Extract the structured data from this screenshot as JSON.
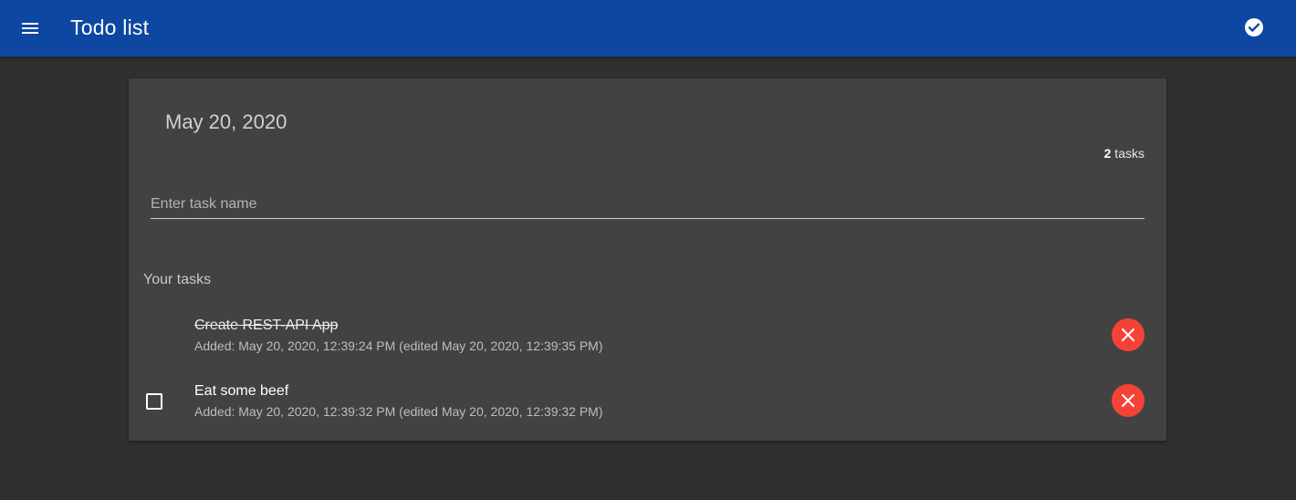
{
  "appbar": {
    "title": "Todo list",
    "color": "#0d47a1",
    "menu_icon": "menu-icon",
    "action_icon": "check-circle-icon"
  },
  "card": {
    "date": "May 20, 2020",
    "task_count": "2",
    "task_count_suffix": " tasks",
    "input": {
      "value": "",
      "placeholder": "Enter task name"
    },
    "section_title": "Your tasks"
  },
  "tasks": [
    {
      "name": "Create REST-API App",
      "meta": "Added: May 20, 2020, 12:39:24 PM (edited May 20, 2020, 12:39:35 PM)",
      "completed": true
    },
    {
      "name": "Eat some beef",
      "meta": "Added: May 20, 2020, 12:39:32 PM (edited May 20, 2020, 12:39:32 PM)",
      "completed": false
    }
  ],
  "colors": {
    "background": "#303030",
    "card": "#424242",
    "delete": "#f44336"
  }
}
